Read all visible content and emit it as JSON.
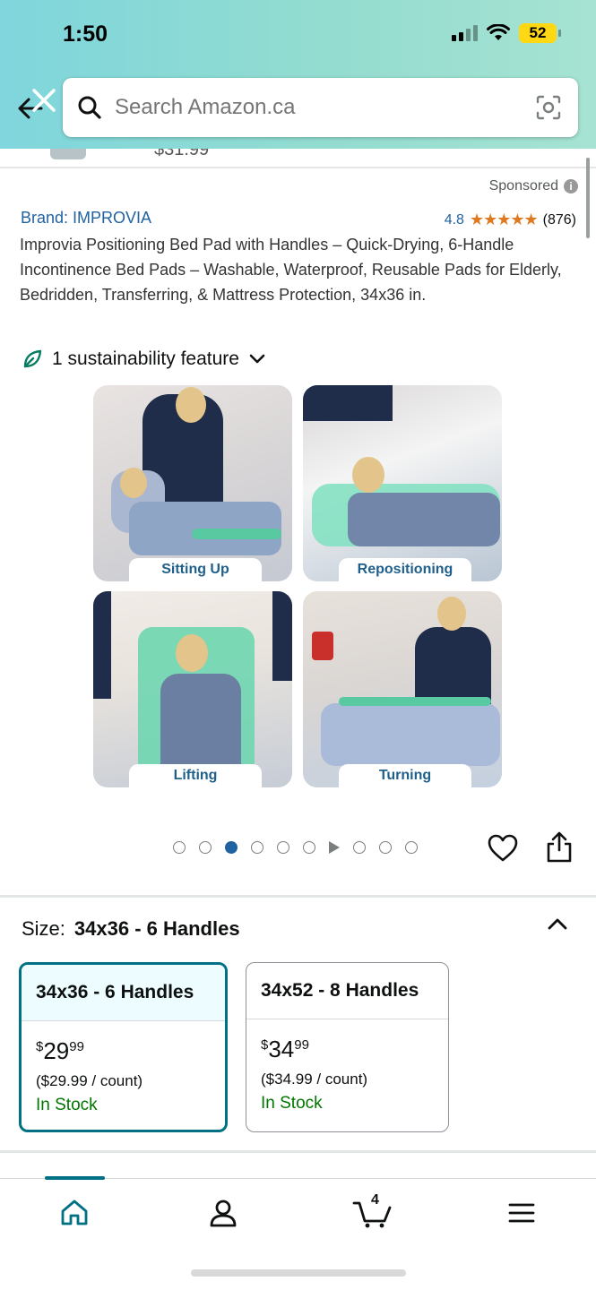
{
  "status_bar": {
    "time": "1:50",
    "battery": "52"
  },
  "search": {
    "placeholder": "Search Amazon.ca"
  },
  "above_fold": {
    "cut_price": "$31.99"
  },
  "listing": {
    "sponsored": "Sponsored",
    "brand": "Brand: IMPROVIA",
    "rating": "4.8",
    "stars": "★★★★★",
    "review_count": "(876)",
    "title": "Improvia Positioning Bed Pad with Handles – Quick-Drying, 6-Handle Incontinence Bed Pads – Washable, Waterproof, Reusable Pads for Elderly, Bedridden, Transferring, & Mattress Protection, 34x36 in.",
    "sustainability": "1 sustainability feature"
  },
  "gallery": {
    "tiles": [
      {
        "caption": "Sitting Up"
      },
      {
        "caption": "Repositioning"
      },
      {
        "caption": "Lifting"
      },
      {
        "caption": "Turning"
      }
    ],
    "active_index": 2
  },
  "size": {
    "label": "Size:",
    "selected": "34x36 - 6 Handles",
    "options": [
      {
        "name": "34x36 - 6 Handles",
        "currency": "$",
        "dollars": "29",
        "cents": "99",
        "unit_price": "($29.99 / count)",
        "stock": "In Stock"
      },
      {
        "name": "34x52 - 8 Handles",
        "currency": "$",
        "dollars": "34",
        "cents": "99",
        "unit_price": "($34.99 / count)",
        "stock": "In Stock"
      }
    ]
  },
  "nav": {
    "cart_count": "4"
  },
  "colors": {
    "link": "#2162a1",
    "teal": "#007185",
    "stock": "#007600",
    "star": "#de7921"
  },
  "icons": [
    "back-arrow-icon",
    "close-icon",
    "search-icon",
    "camera-lens-icon",
    "info-icon",
    "leaf-icon",
    "chevron-down-icon",
    "heart-icon",
    "share-icon",
    "chevron-up-icon",
    "home-icon",
    "account-icon",
    "cart-icon",
    "menu-icon"
  ]
}
